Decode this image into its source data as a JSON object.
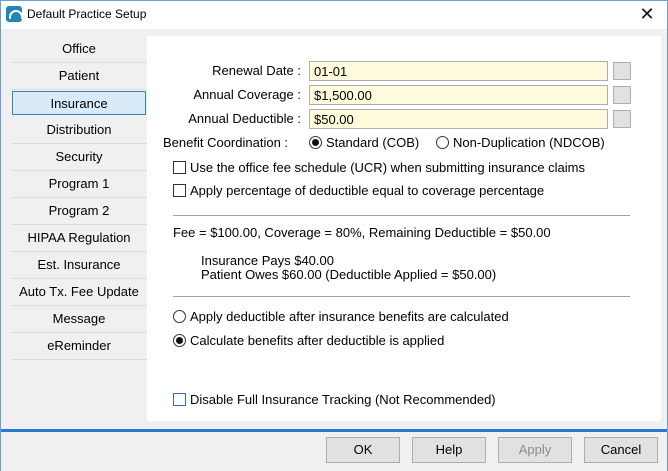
{
  "window": {
    "title": "Default Practice Setup",
    "close_symbol": "✕"
  },
  "sidebar": {
    "items": [
      {
        "label": "Office"
      },
      {
        "label": "Patient"
      },
      {
        "label": "Insurance",
        "active": true
      },
      {
        "label": "Distribution"
      },
      {
        "label": "Security"
      },
      {
        "label": "Program 1"
      },
      {
        "label": "Program 2"
      },
      {
        "label": "HIPAA Regulation"
      },
      {
        "label": "Est. Insurance"
      },
      {
        "label": "Auto Tx. Fee Update"
      },
      {
        "label": "Message"
      },
      {
        "label": "eReminder"
      }
    ]
  },
  "insurance": {
    "renewal_date_label": "Renewal Date :",
    "renewal_date_value": "01-01",
    "annual_coverage_label": "Annual Coverage :",
    "annual_coverage_value": "$1,500.00",
    "annual_deductible_label": "Annual Deductible :",
    "annual_deductible_value": "$50.00",
    "benefit_coordination_label": "Benefit Coordination :",
    "benefit_option_standard": "Standard (COB)",
    "benefit_option_nonduplication": "Non-Duplication (NDCOB)",
    "benefit_selected": "Standard (COB)",
    "checkbox_ucr_label": "Use the office fee schedule (UCR) when submitting insurance claims",
    "checkbox_ucr_checked": false,
    "checkbox_percentage_label": "Apply percentage of deductible equal to coverage percentage",
    "checkbox_percentage_checked": false,
    "example_line": "Fee = $100.00, Coverage = 80%, Remaining Deductible = $50.00",
    "insurance_pays": "Insurance Pays $40.00",
    "patient_owes": "Patient Owes $60.00 (Deductible Applied = $50.00)",
    "radio_after_label": "Apply deductible after insurance benefits are calculated",
    "radio_before_label": "Calculate benefits after deductible is applied",
    "deductible_selected": "Calculate benefits after deductible is applied",
    "disable_tracking_label": "Disable Full Insurance Tracking (Not Recommended)",
    "disable_tracking_checked": false
  },
  "footer": {
    "ok_label": "OK",
    "help_label": "Help",
    "apply_label": "Apply",
    "cancel_label": "Cancel"
  },
  "colors": {
    "input_background": "#fffbdc",
    "active_tab_background": "#d9ebf9",
    "active_tab_border": "#3c7fb1",
    "accent_line": "#2a78d0"
  }
}
